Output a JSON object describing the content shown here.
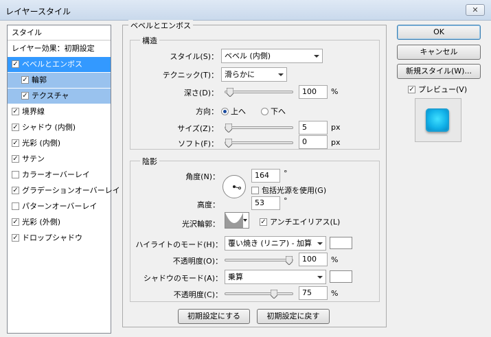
{
  "window": {
    "title": "レイヤースタイル",
    "close_glyph": "✕"
  },
  "left_list": {
    "header": "スタイル",
    "blend_options": "レイヤー効果：初期設定",
    "items": [
      {
        "label": "ベベルとエンボス",
        "checked": true
      },
      {
        "label": "輪郭",
        "checked": true
      },
      {
        "label": "テクスチャ",
        "checked": true
      },
      {
        "label": "境界線",
        "checked": true
      },
      {
        "label": "シャドウ (内側)",
        "checked": true
      },
      {
        "label": "光彩 (内側)",
        "checked": true
      },
      {
        "label": "サテン",
        "checked": true
      },
      {
        "label": "カラーオーバーレイ",
        "checked": false
      },
      {
        "label": "グラデーションオーバーレイ",
        "checked": true
      },
      {
        "label": "パターンオーバーレイ",
        "checked": false
      },
      {
        "label": "光彩 (外側)",
        "checked": true
      },
      {
        "label": "ドロップシャドウ",
        "checked": true
      }
    ]
  },
  "bevel": {
    "group_title": "ベベルとエンボス",
    "structure": {
      "title": "構造",
      "style_label": "スタイル(S)：",
      "style_value": "ベベル (内側)",
      "technique_label": "テクニック(T)：",
      "technique_value": "滑らかに",
      "depth_label": "深さ(D)：",
      "depth_value": "100",
      "depth_unit": "%",
      "direction_label": "方向：",
      "dir_up": "上へ",
      "dir_down": "下へ",
      "size_label": "サイズ(Z)：",
      "size_value": "5",
      "size_unit": "px",
      "soften_label": "ソフト(F)：",
      "soften_value": "0",
      "soften_unit": "px"
    },
    "shading": {
      "title": "陰影",
      "angle_label": "角度(N)：",
      "angle_value": "164",
      "angle_unit": "°",
      "global_light": "包括光源を使用(G)",
      "altitude_label": "高度：",
      "altitude_value": "53",
      "altitude_unit": "°",
      "gloss_label": "光沢輪郭：",
      "antialias": "アンチエイリアス(L)",
      "highlight_mode_label": "ハイライトのモード(H)：",
      "highlight_mode_value": "覆い焼き (リニア) - 加算",
      "highlight_opacity_label": "不透明度(O)：",
      "highlight_opacity_value": "100",
      "highlight_opacity_unit": "%",
      "shadow_mode_label": "シャドウのモード(A)：",
      "shadow_mode_value": "乗算",
      "shadow_opacity_label": "不透明度(C)：",
      "shadow_opacity_value": "75",
      "shadow_opacity_unit": "%"
    },
    "make_default": "初期設定にする",
    "reset_default": "初期設定に戻す"
  },
  "sliders": {
    "depth": 0.02,
    "size": 0.0,
    "soften": 0.0,
    "highlight_opacity": 1.0,
    "shadow_opacity": 0.75
  },
  "right": {
    "ok": "OK",
    "cancel": "キャンセル",
    "new_style": "新規スタイル(W)...",
    "preview": "プレビュー(V)"
  },
  "colors": {
    "selected": "#3399ff",
    "sub_selected": "#99c2ee",
    "preview_tile": "#10b0e8"
  }
}
